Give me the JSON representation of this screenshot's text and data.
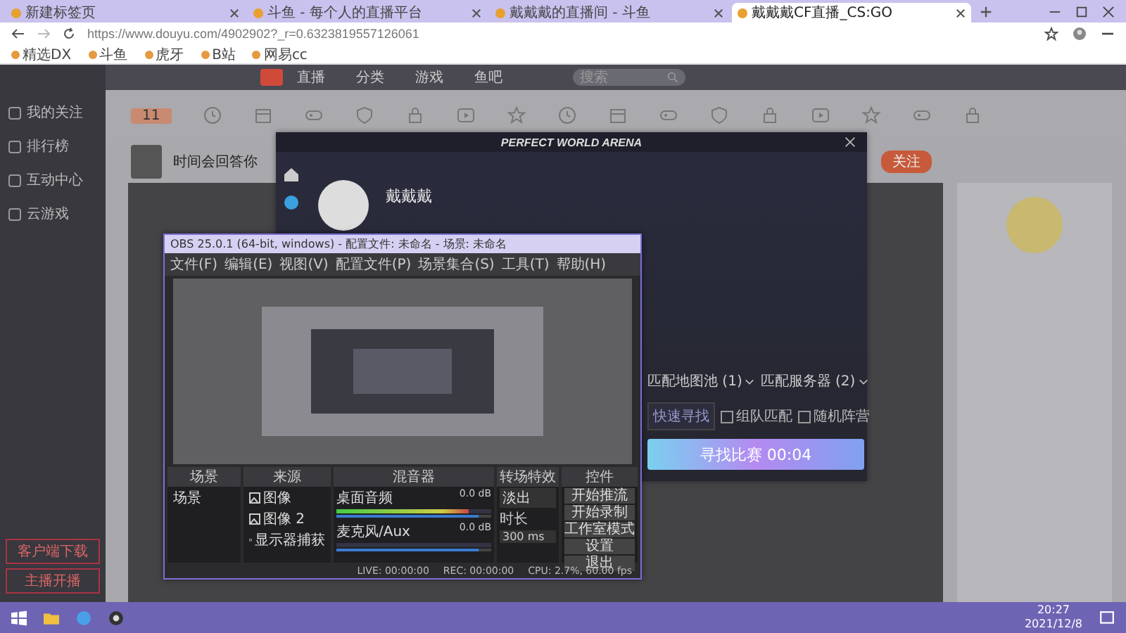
{
  "browser": {
    "tabs": [
      {
        "title": "新建标签页",
        "selected": false
      },
      {
        "title": "斗鱼 - 每个人的直播平台",
        "selected": false
      },
      {
        "title": "戴戴戴的直播间 - 斗鱼",
        "selected": false
      },
      {
        "title": "戴戴戴CF直播_CS:GO",
        "selected": true
      }
    ],
    "url": "https://www.douyu.com/4902902?_r=0.6323819557126061",
    "bookmarks": [
      "精选DX",
      "斗鱼",
      "虎牙",
      "B站",
      "网易cc"
    ]
  },
  "site": {
    "nav": [
      "直播",
      "分类",
      "游戏",
      "鱼吧"
    ],
    "search": {
      "placeholder": "搜索"
    },
    "sidebar": [
      {
        "label": "我的关注"
      },
      {
        "label": "排行榜"
      },
      {
        "label": "互动中心"
      },
      {
        "label": "云游戏"
      }
    ],
    "sidebar_buttons": [
      "客户端下载",
      "主播开播"
    ],
    "day_badge": "11",
    "room": {
      "title": "时间会回答你",
      "follow": "关注"
    }
  },
  "game_client": {
    "title": "PERFECT WORLD ARENA",
    "player": "戴戴戴",
    "dropdowns": [
      "匹配地图池 (1)",
      "匹配服务器 (2)"
    ],
    "quick_button": "快速寻找",
    "options": [
      {
        "label": "组队匹配",
        "checked": false
      },
      {
        "label": "随机阵营",
        "checked": false
      }
    ],
    "search_button": "寻找比赛 00:04"
  },
  "obs": {
    "title": "OBS 25.0.1 (64-bit, windows) - 配置文件: 未命名 - 场景: 未命名",
    "menu": [
      "文件(F)",
      "编辑(E)",
      "视图(V)",
      "配置文件(P)",
      "场景集合(S)",
      "工具(T)",
      "帮助(H)"
    ],
    "docks": [
      "场景",
      "来源",
      "混音器",
      "转场特效",
      "控件"
    ],
    "scenes": [
      {
        "name": "场景",
        "selected": false
      }
    ],
    "sources": [
      {
        "name": "图像",
        "kind": "image"
      },
      {
        "name": "图像 2",
        "kind": "image"
      },
      {
        "name": "显示器捕获",
        "kind": "display"
      }
    ],
    "mixer": [
      {
        "name": "桌面音频",
        "reading": "0.0 dB",
        "level": 0.85,
        "volume": {
          "level": 0.92
        }
      },
      {
        "name": "麦克风/Aux",
        "reading": "0.0 dB",
        "level": 0.0,
        "volume": {
          "level": 0.92
        }
      }
    ],
    "transition": {
      "value": "淡出",
      "duration_label": "时长",
      "duration": "300 ms"
    },
    "controls": [
      "开始推流",
      "开始录制",
      "工作室模式",
      "设置",
      "退出"
    ],
    "status": [
      "LIVE: 00:00:00",
      "REC: 00:00:00",
      "CPU: 2.7%, 60.00 fps"
    ]
  },
  "taskbar": {
    "time": "20:27",
    "date": "2021/12/8"
  }
}
